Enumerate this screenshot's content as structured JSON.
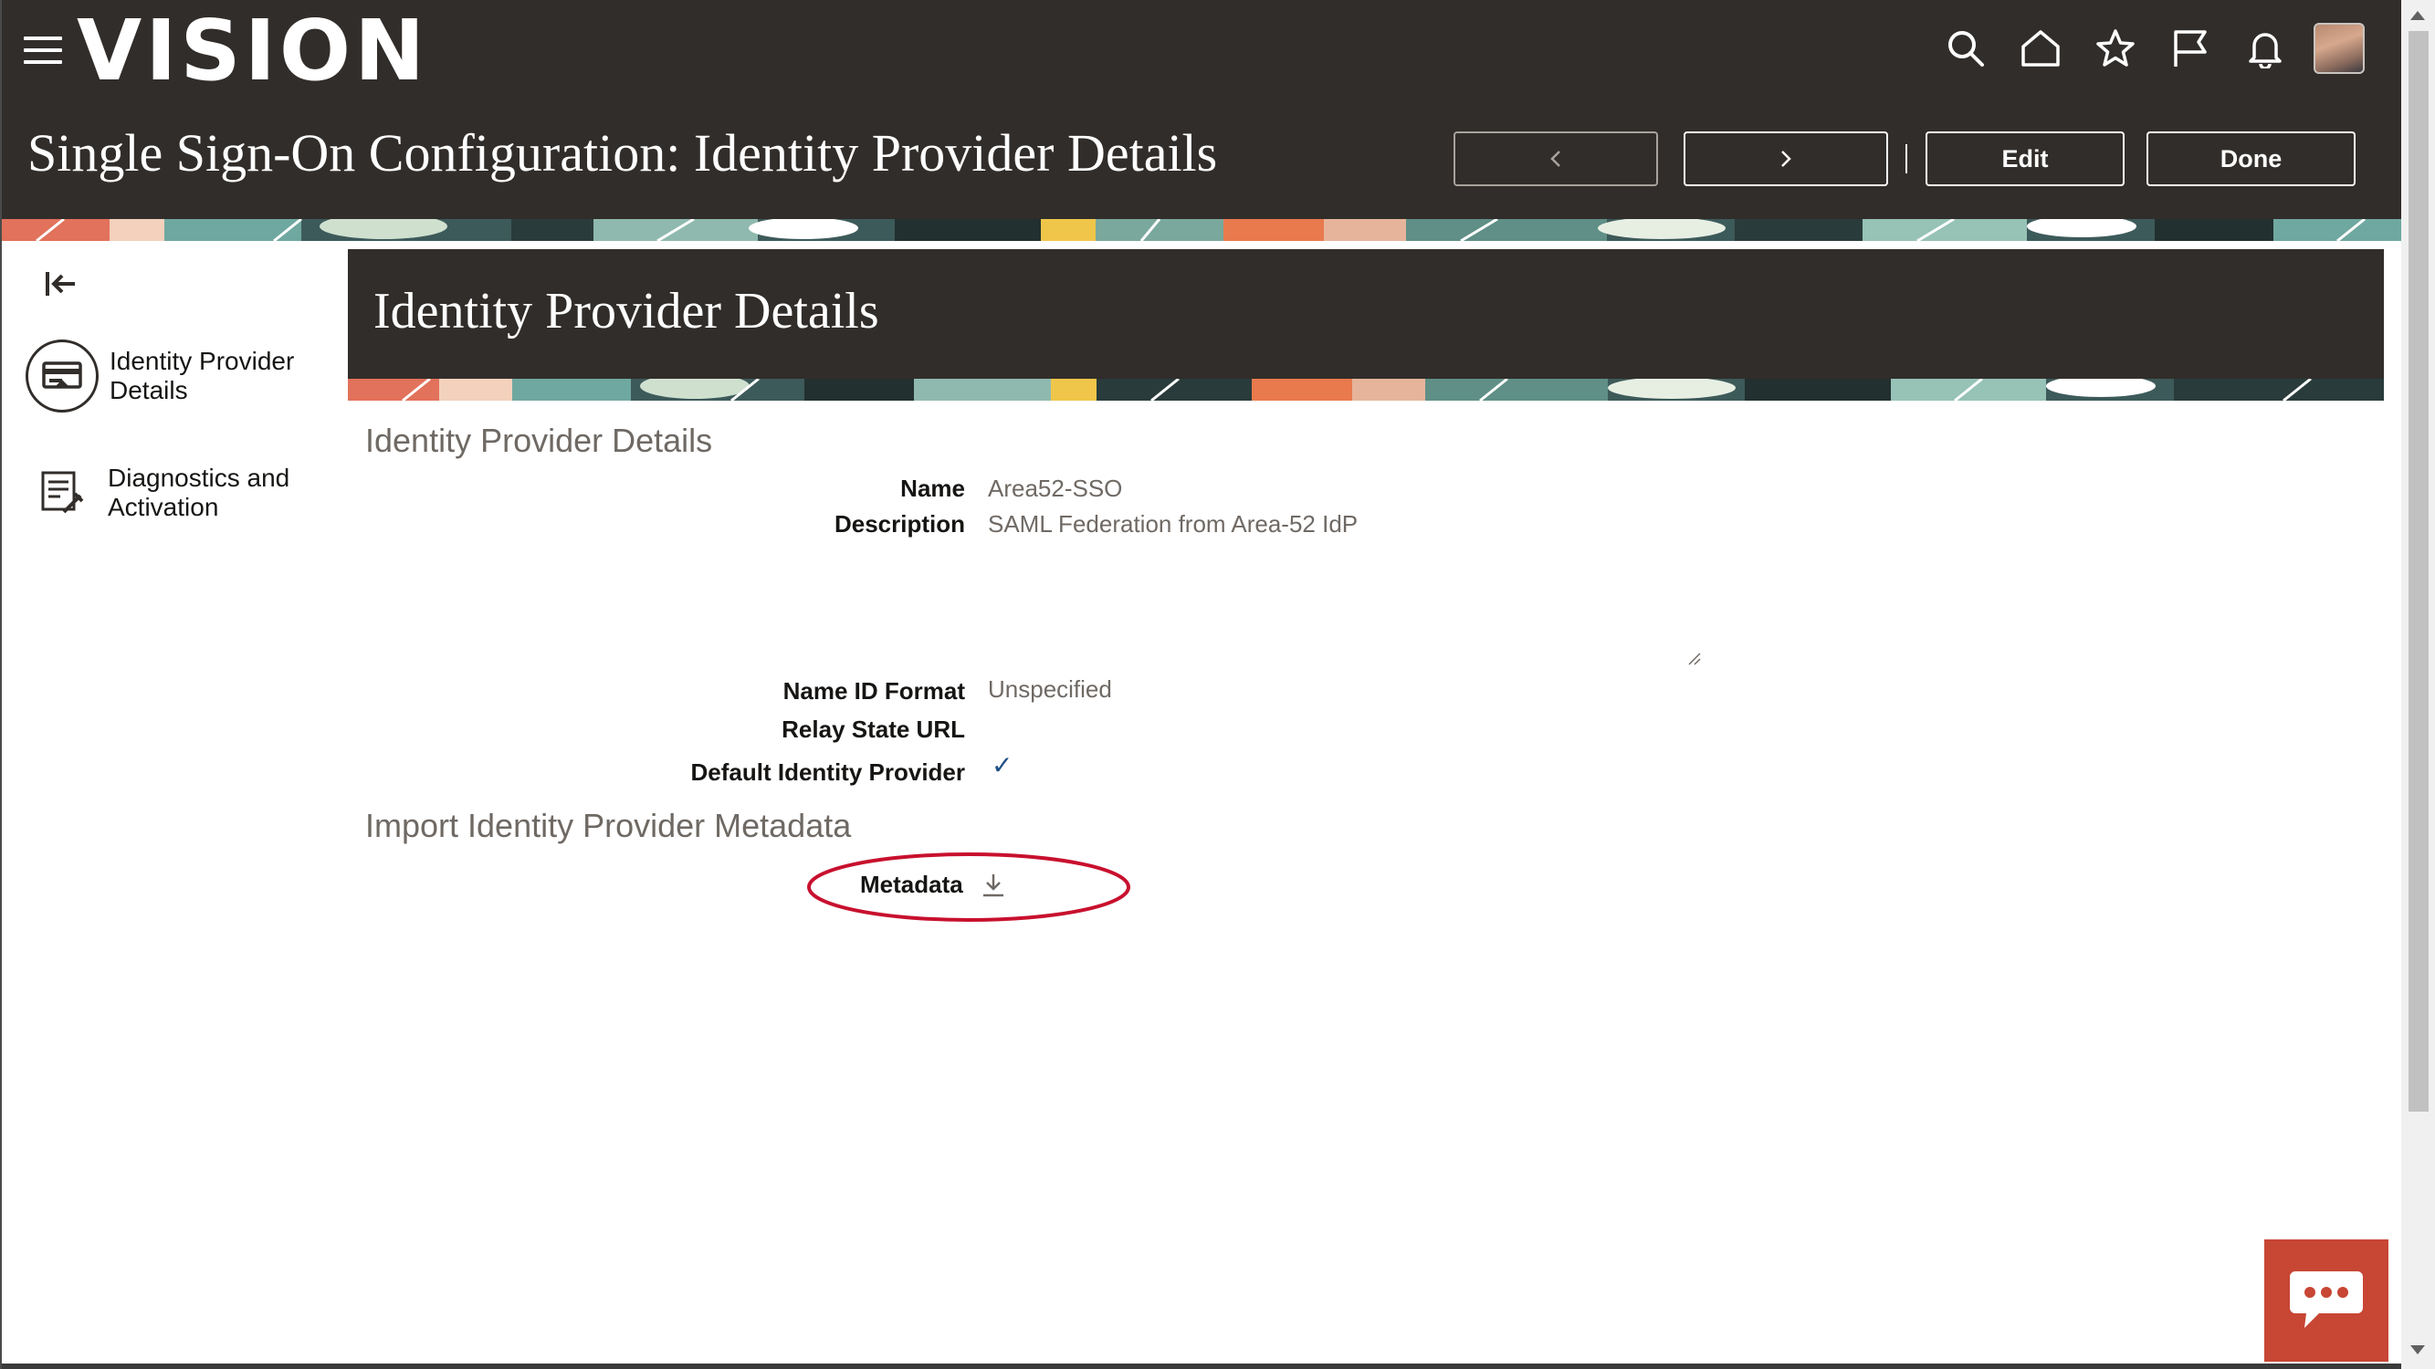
{
  "header": {
    "logo": "VISION",
    "page_title": "Single Sign-On Configuration: Identity Provider Details",
    "buttons": {
      "previous": "<",
      "next": ">",
      "edit": "Edit",
      "done": "Done"
    },
    "icons": [
      "search-icon",
      "home-icon",
      "favorites-star-icon",
      "flag-icon",
      "notifications-bell-icon",
      "user-avatar"
    ]
  },
  "sidebar": {
    "items": [
      {
        "label": "Identity Provider Details",
        "icon": "identity-card-icon",
        "selected": true
      },
      {
        "label": "Diagnostics and Activation",
        "icon": "diagnostics-icon",
        "selected": false
      }
    ]
  },
  "panel": {
    "title": "Identity Provider Details"
  },
  "details": {
    "section_title": "Identity Provider Details",
    "name_label": "Name",
    "name_value": "Area52-SSO",
    "description_label": "Description",
    "description_value": "SAML Federation from Area-52 IdP",
    "name_id_format_label": "Name ID Format",
    "name_id_format_value": "Unspecified",
    "relay_state_url_label": "Relay State URL",
    "relay_state_url_value": "",
    "default_idp_label": "Default Identity Provider",
    "default_idp_checked": true,
    "check_mark": "✓"
  },
  "metadata": {
    "section_title": "Import Identity Provider Metadata",
    "label": "Metadata"
  },
  "colors": {
    "header_bg": "#312d2a",
    "chat_button": "#c74634",
    "highlight_oval": "#c8102e"
  }
}
